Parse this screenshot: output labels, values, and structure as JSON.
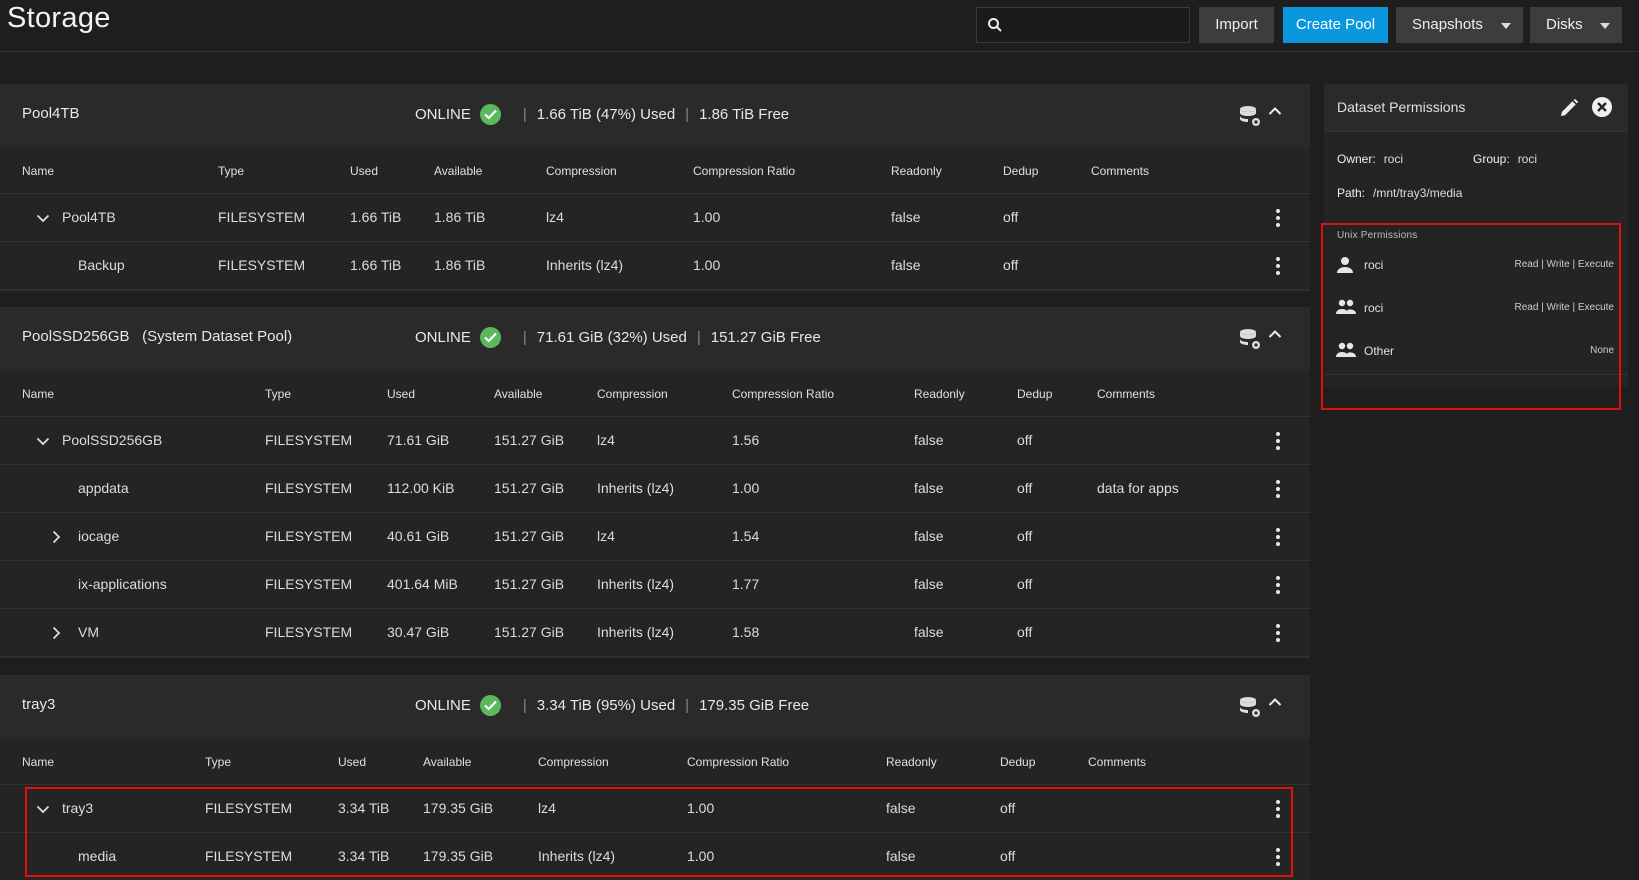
{
  "header": {
    "title": "Storage",
    "search_placeholder": "",
    "buttons": {
      "import": "Import",
      "create_pool": "Create Pool",
      "snapshots": "Snapshots",
      "disks": "Disks"
    }
  },
  "colors": {
    "accent": "#0b97dd",
    "online": "#5cb85c",
    "highlight": "#e01010"
  },
  "pools": [
    {
      "name": "Pool4TB",
      "status": "ONLINE",
      "used": "1.66 TiB (47%) Used",
      "free": "1.86 TiB Free",
      "columns": [
        "Name",
        "Type",
        "Used",
        "Available",
        "Compression",
        "Compression Ratio",
        "Readonly",
        "Dedup",
        "Comments"
      ],
      "rows": [
        {
          "name": "Pool4TB",
          "type": "FILESYSTEM",
          "used": "1.66 TiB",
          "available": "1.86 TiB",
          "compression": "lz4",
          "ratio": "1.00",
          "readonly": "false",
          "dedup": "off",
          "comments": ""
        },
        {
          "name": "Backup",
          "type": "FILESYSTEM",
          "used": "1.66 TiB",
          "available": "1.86 TiB",
          "compression": "Inherits (lz4)",
          "ratio": "1.00",
          "readonly": "false",
          "dedup": "off",
          "comments": ""
        }
      ]
    },
    {
      "name": "PoolSSD256GB",
      "subtitle": "(System Dataset Pool)",
      "status": "ONLINE",
      "used": "71.61 GiB (32%) Used",
      "free": "151.27 GiB Free",
      "columns": [
        "Name",
        "Type",
        "Used",
        "Available",
        "Compression",
        "Compression Ratio",
        "Readonly",
        "Dedup",
        "Comments"
      ],
      "rows": [
        {
          "name": "PoolSSD256GB",
          "type": "FILESYSTEM",
          "used": "71.61 GiB",
          "available": "151.27 GiB",
          "compression": "lz4",
          "ratio": "1.56",
          "readonly": "false",
          "dedup": "off",
          "comments": ""
        },
        {
          "name": "appdata",
          "type": "FILESYSTEM",
          "used": "112.00 KiB",
          "available": "151.27 GiB",
          "compression": "Inherits (lz4)",
          "ratio": "1.00",
          "readonly": "false",
          "dedup": "off",
          "comments": "data for apps"
        },
        {
          "name": "iocage",
          "type": "FILESYSTEM",
          "used": "40.61 GiB",
          "available": "151.27 GiB",
          "compression": "lz4",
          "ratio": "1.54",
          "readonly": "false",
          "dedup": "off",
          "comments": ""
        },
        {
          "name": "ix-applications",
          "type": "FILESYSTEM",
          "used": "401.64 MiB",
          "available": "151.27 GiB",
          "compression": "Inherits (lz4)",
          "ratio": "1.77",
          "readonly": "false",
          "dedup": "off",
          "comments": ""
        },
        {
          "name": "VM",
          "type": "FILESYSTEM",
          "used": "30.47 GiB",
          "available": "151.27 GiB",
          "compression": "Inherits (lz4)",
          "ratio": "1.58",
          "readonly": "false",
          "dedup": "off",
          "comments": ""
        }
      ]
    },
    {
      "name": "tray3",
      "status": "ONLINE",
      "used": "3.34 TiB (95%) Used",
      "free": "179.35 GiB Free",
      "columns": [
        "Name",
        "Type",
        "Used",
        "Available",
        "Compression",
        "Compression Ratio",
        "Readonly",
        "Dedup",
        "Comments"
      ],
      "rows": [
        {
          "name": "tray3",
          "type": "FILESYSTEM",
          "used": "3.34 TiB",
          "available": "179.35 GiB",
          "compression": "lz4",
          "ratio": "1.00",
          "readonly": "false",
          "dedup": "off",
          "comments": ""
        },
        {
          "name": "media",
          "type": "FILESYSTEM",
          "used": "3.34 TiB",
          "available": "179.35 GiB",
          "compression": "Inherits (lz4)",
          "ratio": "1.00",
          "readonly": "false",
          "dedup": "off",
          "comments": ""
        }
      ]
    }
  ],
  "permissions": {
    "title": "Dataset Permissions",
    "owner_label": "Owner:",
    "owner": "roci",
    "group_label": "Group:",
    "group": "roci",
    "path_label": "Path:",
    "path": "/mnt/tray3/media",
    "unix_label": "Unix Permissions",
    "entries": [
      {
        "who": "roci",
        "rights": "Read | Write | Execute",
        "icon": "user-icon"
      },
      {
        "who": "roci",
        "rights": "Read | Write | Execute",
        "icon": "group-icon"
      },
      {
        "who": "Other",
        "rights": "None",
        "icon": "group-icon"
      }
    ]
  }
}
